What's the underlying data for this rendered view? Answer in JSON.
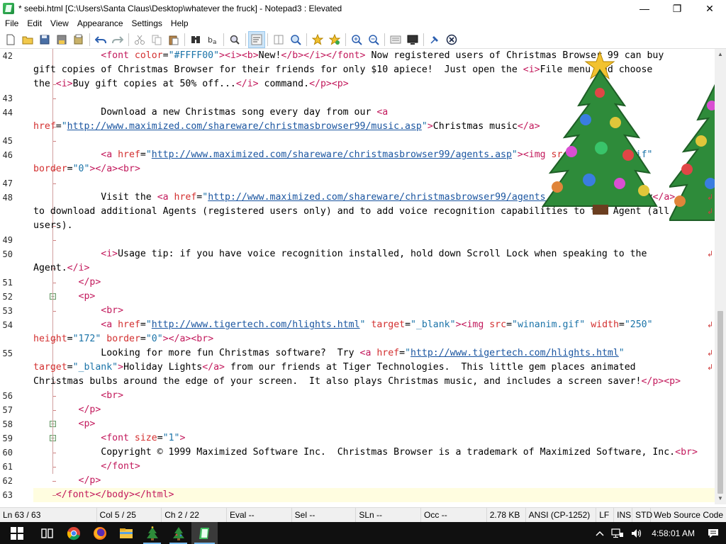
{
  "window": {
    "title": "* seebi.html [C:\\Users\\Santa Claus\\Desktop\\whatever the fruck] - Notepad3 : Elevated",
    "minimize_glyph": "—",
    "maximize_glyph": "❐",
    "close_glyph": "✕"
  },
  "menu": [
    "File",
    "Edit",
    "View",
    "Appearance",
    "Settings",
    "Help"
  ],
  "toolbar": {
    "icons": [
      "new-file-icon",
      "open-folder-icon",
      "save-icon",
      "save-as-icon",
      "save-copy-icon",
      "undo-icon",
      "redo-icon",
      "cut-icon",
      "copy-icon",
      "paste-icon",
      "find-icon",
      "replace-icon",
      "find-in-files-icon",
      "word-wrap-icon",
      "column-select-icon",
      "search-zoom-icon",
      "favorite-add-icon",
      "favorites-icon",
      "zoom-in-icon",
      "zoom-out-icon",
      "schema-icon",
      "screen-icon",
      "pin-icon",
      "exit-icon"
    ],
    "active_icon": "word-wrap-icon"
  },
  "editor": {
    "lines": [
      {
        "num": "42",
        "segments": [
          {
            "row": 0,
            "parts": [
              [
                "ind",
                "            "
              ],
              [
                "tag",
                "<font "
              ],
              [
                "attr",
                "color"
              ],
              [
                "txt",
                "="
              ],
              [
                "str",
                "\"#FFFF00\""
              ],
              [
                "tag",
                ">"
              ],
              [
                "tag",
                "<i><b>"
              ],
              [
                "txt",
                "New!"
              ],
              [
                "tag",
                "</b></i></font>"
              ],
              [
                "txt",
                " Now registered users of Christmas Browser 99 can buy"
              ]
            ]
          },
          {
            "row": 1,
            "parts": [
              [
                "txt",
                "gift copies of Christmas Browser for their friends for only $10 apiece!  Just open the "
              ],
              [
                "tag",
                "<i>"
              ],
              [
                "txt",
                "File menu and choose"
              ]
            ]
          },
          {
            "row": 2,
            "parts": [
              [
                "txt",
                "the "
              ],
              [
                "tag",
                "<i>"
              ],
              [
                "txt",
                "Buy gift copies at 50% off..."
              ],
              [
                "tag",
                "</i>"
              ],
              [
                "txt",
                " command."
              ],
              [
                "tag",
                "</p><p>"
              ]
            ]
          }
        ]
      },
      {
        "num": "43",
        "segments": [
          {
            "row": 3,
            "parts": []
          }
        ]
      },
      {
        "num": "44",
        "segments": [
          {
            "row": 4,
            "parts": [
              [
                "ind",
                "            "
              ],
              [
                "txt",
                "Download a new Christmas song every day from our "
              ],
              [
                "tag",
                "<a"
              ]
            ]
          },
          {
            "row": 5,
            "parts": [
              [
                "attr",
                "href"
              ],
              [
                "txt",
                "="
              ],
              [
                "str",
                "\""
              ],
              [
                "url",
                "http://www.maximized.com/shareware/christmasbrowser99/music.asp"
              ],
              [
                "str",
                "\""
              ],
              [
                "tag",
                ">"
              ],
              [
                "txt",
                "Christmas music"
              ],
              [
                "tag",
                "</a>"
              ]
            ]
          }
        ]
      },
      {
        "num": "45",
        "segments": [
          {
            "row": 6,
            "parts": []
          }
        ]
      },
      {
        "num": "46",
        "segments": [
          {
            "row": 7,
            "parts": [
              [
                "ind",
                "            "
              ],
              [
                "tag",
                "<a "
              ],
              [
                "attr",
                "href"
              ],
              [
                "txt",
                "="
              ],
              [
                "str",
                "\""
              ],
              [
                "url",
                "http://www.maximized.com/shareware/christmasbrowser99/agents.asp"
              ],
              [
                "str",
                "\""
              ],
              [
                "tag",
                ">"
              ],
              [
                "tag",
                "<img "
              ],
              [
                "attr",
                "src"
              ],
              [
                "txt",
                "="
              ],
              [
                "str",
                "\"gallery1.gif\""
              ]
            ]
          },
          {
            "row": 8,
            "parts": [
              [
                "attr",
                "border"
              ],
              [
                "txt",
                "="
              ],
              [
                "str",
                "\"0\""
              ],
              [
                "tag",
                "></a><br>"
              ]
            ]
          }
        ]
      },
      {
        "num": "47",
        "segments": [
          {
            "row": 9,
            "parts": []
          }
        ]
      },
      {
        "num": "48",
        "wrap": [
          10,
          11
        ],
        "segments": [
          {
            "row": 10,
            "parts": [
              [
                "ind",
                "            "
              ],
              [
                "txt",
                "Visit the "
              ],
              [
                "tag",
                "<a "
              ],
              [
                "attr",
                "href"
              ],
              [
                "txt",
                "="
              ],
              [
                "str",
                "\""
              ],
              [
                "url",
                "http://www.maximized.com/shareware/christmasbrowser99/agents.asp"
              ],
              [
                "str",
                "\""
              ],
              [
                "tag",
                ">"
              ],
              [
                "txt",
                "Agent Gallery"
              ],
              [
                "tag",
                "</a>"
              ]
            ]
          },
          {
            "row": 11,
            "parts": [
              [
                "txt",
                "to download additional Agents (registered users only) and to add voice recognition capabilities to the Agent (all"
              ]
            ]
          },
          {
            "row": 12,
            "parts": [
              [
                "txt",
                "users)."
              ]
            ]
          }
        ]
      },
      {
        "num": "49",
        "segments": [
          {
            "row": 13,
            "parts": []
          }
        ]
      },
      {
        "num": "50",
        "wrap": [
          14
        ],
        "segments": [
          {
            "row": 14,
            "parts": [
              [
                "ind",
                "            "
              ],
              [
                "tag",
                "<i>"
              ],
              [
                "txt",
                "Usage tip: if you have voice recognition installed, hold down Scroll Lock when speaking to the"
              ]
            ]
          },
          {
            "row": 15,
            "parts": [
              [
                "txt",
                "Agent."
              ],
              [
                "tag",
                "</i>"
              ]
            ]
          }
        ]
      },
      {
        "num": "51",
        "segments": [
          {
            "row": 16,
            "parts": [
              [
                "ind",
                "        "
              ],
              [
                "tag",
                "</p>"
              ]
            ]
          }
        ]
      },
      {
        "num": "52",
        "fold": true,
        "segments": [
          {
            "row": 17,
            "parts": [
              [
                "ind",
                "        "
              ],
              [
                "tag",
                "<p>"
              ]
            ]
          }
        ]
      },
      {
        "num": "53",
        "segments": [
          {
            "row": 18,
            "parts": [
              [
                "ind",
                "            "
              ],
              [
                "tag",
                "<br>"
              ]
            ]
          }
        ]
      },
      {
        "num": "54",
        "wrap": [
          19
        ],
        "segments": [
          {
            "row": 19,
            "parts": [
              [
                "ind",
                "            "
              ],
              [
                "tag",
                "<a "
              ],
              [
                "attr",
                "href"
              ],
              [
                "txt",
                "="
              ],
              [
                "str",
                "\""
              ],
              [
                "url",
                "http://www.tigertech.com/hlights.html"
              ],
              [
                "str",
                "\""
              ],
              [
                "txt",
                " "
              ],
              [
                "attr",
                "target"
              ],
              [
                "txt",
                "="
              ],
              [
                "str",
                "\"_blank\""
              ],
              [
                "tag",
                ">"
              ],
              [
                "tag",
                "<img "
              ],
              [
                "attr",
                "src"
              ],
              [
                "txt",
                "="
              ],
              [
                "str",
                "\"winanim.gif\""
              ],
              [
                "txt",
                " "
              ],
              [
                "attr",
                "width"
              ],
              [
                "txt",
                "="
              ],
              [
                "str",
                "\"250\""
              ]
            ]
          },
          {
            "row": 20,
            "parts": [
              [
                "attr",
                "height"
              ],
              [
                "txt",
                "="
              ],
              [
                "str",
                "\"172\""
              ],
              [
                "txt",
                " "
              ],
              [
                "attr",
                "border"
              ],
              [
                "txt",
                "="
              ],
              [
                "str",
                "\"0\""
              ],
              [
                "tag",
                "></a><br>"
              ]
            ]
          }
        ]
      },
      {
        "num": "55",
        "wrap": [
          21,
          22
        ],
        "segments": [
          {
            "row": 21,
            "parts": [
              [
                "ind",
                "            "
              ],
              [
                "txt",
                "Looking for more fun Christmas software?  Try "
              ],
              [
                "tag",
                "<a "
              ],
              [
                "attr",
                "href"
              ],
              [
                "txt",
                "="
              ],
              [
                "str",
                "\""
              ],
              [
                "url",
                "http://www.tigertech.com/hlights.html"
              ],
              [
                "str",
                "\""
              ]
            ]
          },
          {
            "row": 22,
            "parts": [
              [
                "attr",
                "target"
              ],
              [
                "txt",
                "="
              ],
              [
                "str",
                "\"_blank\""
              ],
              [
                "tag",
                ">"
              ],
              [
                "txt",
                "Holiday Lights"
              ],
              [
                "tag",
                "</a>"
              ],
              [
                "txt",
                " from our friends at Tiger Technologies.  This little gem places animated"
              ]
            ]
          },
          {
            "row": 23,
            "parts": [
              [
                "txt",
                "Christmas bulbs around the edge of your screen.  It also plays Christmas music, and includes a screen saver!"
              ],
              [
                "tag",
                "</p><p>"
              ]
            ]
          }
        ]
      },
      {
        "num": "56",
        "segments": [
          {
            "row": 24,
            "parts": [
              [
                "ind",
                "            "
              ],
              [
                "tag",
                "<br>"
              ]
            ]
          }
        ]
      },
      {
        "num": "57",
        "segments": [
          {
            "row": 25,
            "parts": [
              [
                "ind",
                "        "
              ],
              [
                "tag",
                "</p>"
              ]
            ]
          }
        ]
      },
      {
        "num": "58",
        "fold": true,
        "segments": [
          {
            "row": 26,
            "parts": [
              [
                "ind",
                "        "
              ],
              [
                "tag",
                "<p>"
              ]
            ]
          }
        ]
      },
      {
        "num": "59",
        "fold": true,
        "segments": [
          {
            "row": 27,
            "parts": [
              [
                "ind",
                "            "
              ],
              [
                "tag",
                "<font "
              ],
              [
                "attr",
                "size"
              ],
              [
                "txt",
                "="
              ],
              [
                "str",
                "\"1\""
              ],
              [
                "tag",
                ">"
              ]
            ]
          }
        ]
      },
      {
        "num": "60",
        "segments": [
          {
            "row": 28,
            "parts": [
              [
                "ind",
                "            "
              ],
              [
                "txt",
                "Copyright © 1999 Maximized Software Inc.  Christmas Browser is a trademark of Maximized Software, Inc."
              ],
              [
                "tag",
                "<br>"
              ]
            ]
          }
        ]
      },
      {
        "num": "61",
        "segments": [
          {
            "row": 29,
            "parts": [
              [
                "ind",
                "            "
              ],
              [
                "tag",
                "</font>"
              ]
            ]
          }
        ]
      },
      {
        "num": "62",
        "segments": [
          {
            "row": 30,
            "parts": [
              [
                "ind",
                "        "
              ],
              [
                "tag",
                "</p>"
              ]
            ]
          }
        ]
      },
      {
        "num": "63",
        "current": true,
        "segments": [
          {
            "row": 31,
            "parts": [
              [
                "ind",
                "    "
              ],
              [
                "tag",
                "</font></body></html>"
              ]
            ]
          }
        ]
      }
    ]
  },
  "statusbar": [
    "Ln 63 / 63",
    "Col 5 / 25",
    "Ch 2 / 22",
    "Eval --",
    "Sel --",
    "SLn --",
    "Occ --",
    "2.78 KB",
    "ANSI (CP-1252)",
    "LF",
    "INS",
    "STD",
    "Web Source Code"
  ],
  "taskbar": {
    "apps": [
      "start-icon",
      "task-view-icon",
      "chrome-icon",
      "firefox-icon",
      "file-explorer-icon",
      "tree-app-icon-1",
      "tree-app-icon-2",
      "notepad3-icon"
    ],
    "clock": "4:58:01 AM"
  },
  "colors": {
    "tag": "#c2185b",
    "attr": "#d32f2f",
    "string": "#1a73a8",
    "url": "#1a55a0",
    "current_line": "#fffde0",
    "taskbar": "#101010"
  }
}
